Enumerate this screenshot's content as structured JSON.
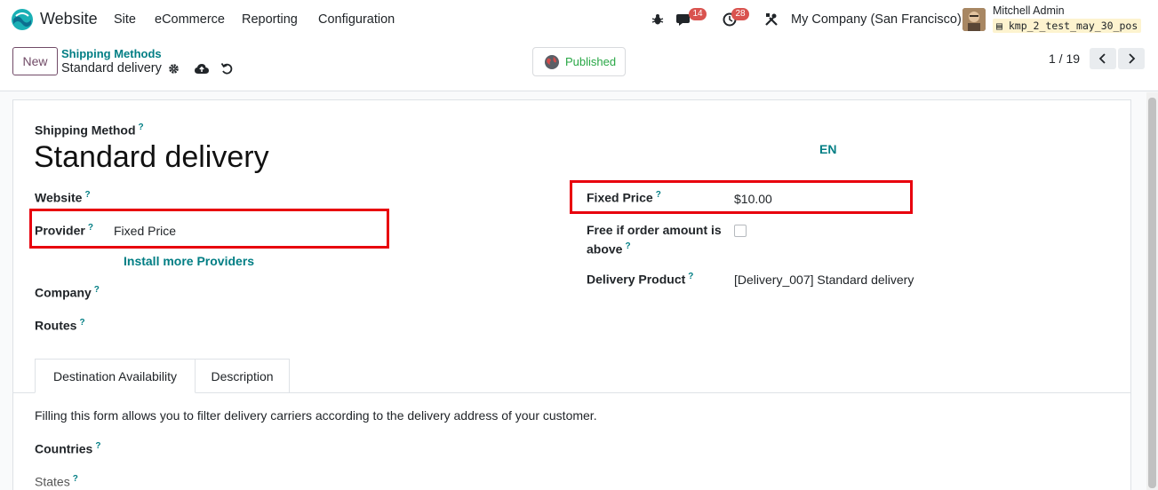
{
  "navbar": {
    "app_name": "Website",
    "menu": [
      "Site",
      "eCommerce",
      "Reporting",
      "Configuration"
    ],
    "messages_count": "14",
    "activities_count": "28",
    "company": "My Company (San Francisco)",
    "user_name": "Mitchell Admin",
    "database": "kmp_2_test_may_30_pos"
  },
  "control_panel": {
    "new_label": "New",
    "breadcrumb_parent": "Shipping Methods",
    "breadcrumb_current": "Standard delivery",
    "published_label": "Published",
    "pager": "1 / 19"
  },
  "form": {
    "shipping_method_label": "Shipping Method",
    "title": "Standard delivery",
    "lang": "EN",
    "help_mark": "?",
    "website_label": "Website",
    "provider_label": "Provider",
    "provider_value": "Fixed Price",
    "install_providers": "Install more Providers",
    "company_label": "Company",
    "routes_label": "Routes",
    "fixed_price_label": "Fixed Price",
    "fixed_price_value": "$10.00",
    "free_label_line1": "Free if order amount is",
    "free_label_line2": "above",
    "free_checked": false,
    "delivery_product_label": "Delivery Product",
    "delivery_product_value": "[Delivery_007] Standard delivery"
  },
  "tabs": {
    "items": [
      "Destination Availability",
      "Description"
    ],
    "active": "Destination Availability",
    "description_text": "Filling this form allows you to filter delivery carriers according to the delivery address of your customer.",
    "countries_label": "Countries",
    "states_label": "States"
  },
  "colors": {
    "accent": "#017e84",
    "brand": "#714b67",
    "highlight_box": "#e8000d",
    "published": "#28a745"
  }
}
